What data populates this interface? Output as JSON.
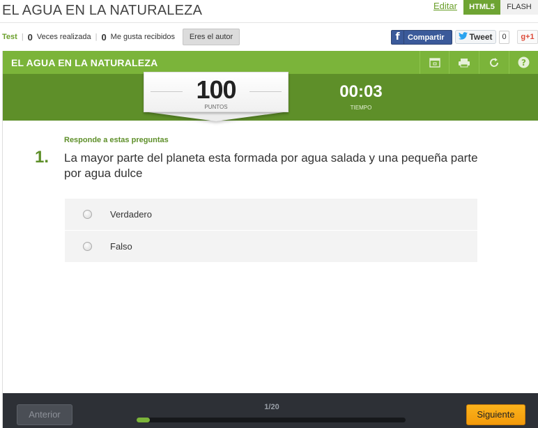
{
  "page": {
    "title": "EL AGUA EN LA NATURALEZA",
    "edit_link": "Editar",
    "formats": [
      "HTML5",
      "FLASH"
    ]
  },
  "stats": {
    "type_label": "Test",
    "times_count": "0",
    "times_label": "Veces realizada",
    "likes_count": "0",
    "likes_label": "Me gusta recibidos",
    "author_button": "Eres el autor"
  },
  "social": {
    "facebook_label": "Compartir",
    "facebook_icon": "f",
    "tweet_label": "Tweet",
    "tweet_count": "0",
    "gplus_label": "g+1"
  },
  "quiz": {
    "title": "EL AGUA EN LA NATURALEZA",
    "toolbar_icons": [
      "fullscreen-icon",
      "print-icon",
      "restart-icon",
      "help-icon"
    ],
    "score_value": "100",
    "score_label": "PUNTOS",
    "time_value": "00:03",
    "time_label": "TIEMPO",
    "instruction": "Responde a estas preguntas",
    "question_number": "1.",
    "question_text": "La mayor parte del planeta esta formada por agua salada y una pequeña parte por agua dulce",
    "options": [
      "Verdadero",
      "Falso"
    ]
  },
  "footer": {
    "prev_label": "Anterior",
    "next_label": "Siguiente",
    "progress_text": "1/20",
    "progress_fraction": 0.05
  },
  "colors": {
    "accent_green": "#7bb43a",
    "dark_green": "#5e8f29",
    "next_orange": "#f5a40f",
    "footer_dark": "#2d3036"
  }
}
